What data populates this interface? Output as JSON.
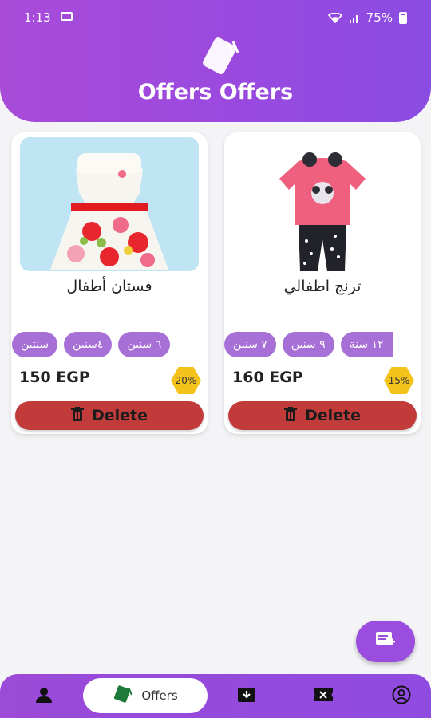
{
  "status_bar": {
    "time": "1:13",
    "battery": "75%",
    "icons": [
      "gallery-icon",
      "wifi-icon",
      "signal-icon",
      "battery-icon"
    ]
  },
  "header": {
    "title": "Offers Offers",
    "logo_icon": "cards-logo-icon"
  },
  "products": [
    {
      "name": "فستان أطفال",
      "sizes": [
        "٦ سنين",
        "٤سنين",
        "سنتين"
      ],
      "price": "150 EGP",
      "discount": "20%",
      "delete_label": "Delete",
      "image": "floral-dress"
    },
    {
      "name": "ترنج اطفالي",
      "sizes": [
        "١٢ سنة",
        "٩ سنين",
        "٧ سنين"
      ],
      "price": "160 EGP",
      "discount": "15%",
      "delete_label": "Delete",
      "image": "pink-tracksuit"
    }
  ],
  "fab": {
    "icon": "add-note-icon"
  },
  "bottom_nav": {
    "active_label": "Offers",
    "items": [
      "person-icon",
      "offers-icon",
      "download-box-icon",
      "ticket-icon",
      "account-circle-icon"
    ]
  },
  "colors": {
    "primary": "#9a49df",
    "chip": "#a770d6",
    "delete": "#c23b3b",
    "badge": "#f4c31b"
  }
}
